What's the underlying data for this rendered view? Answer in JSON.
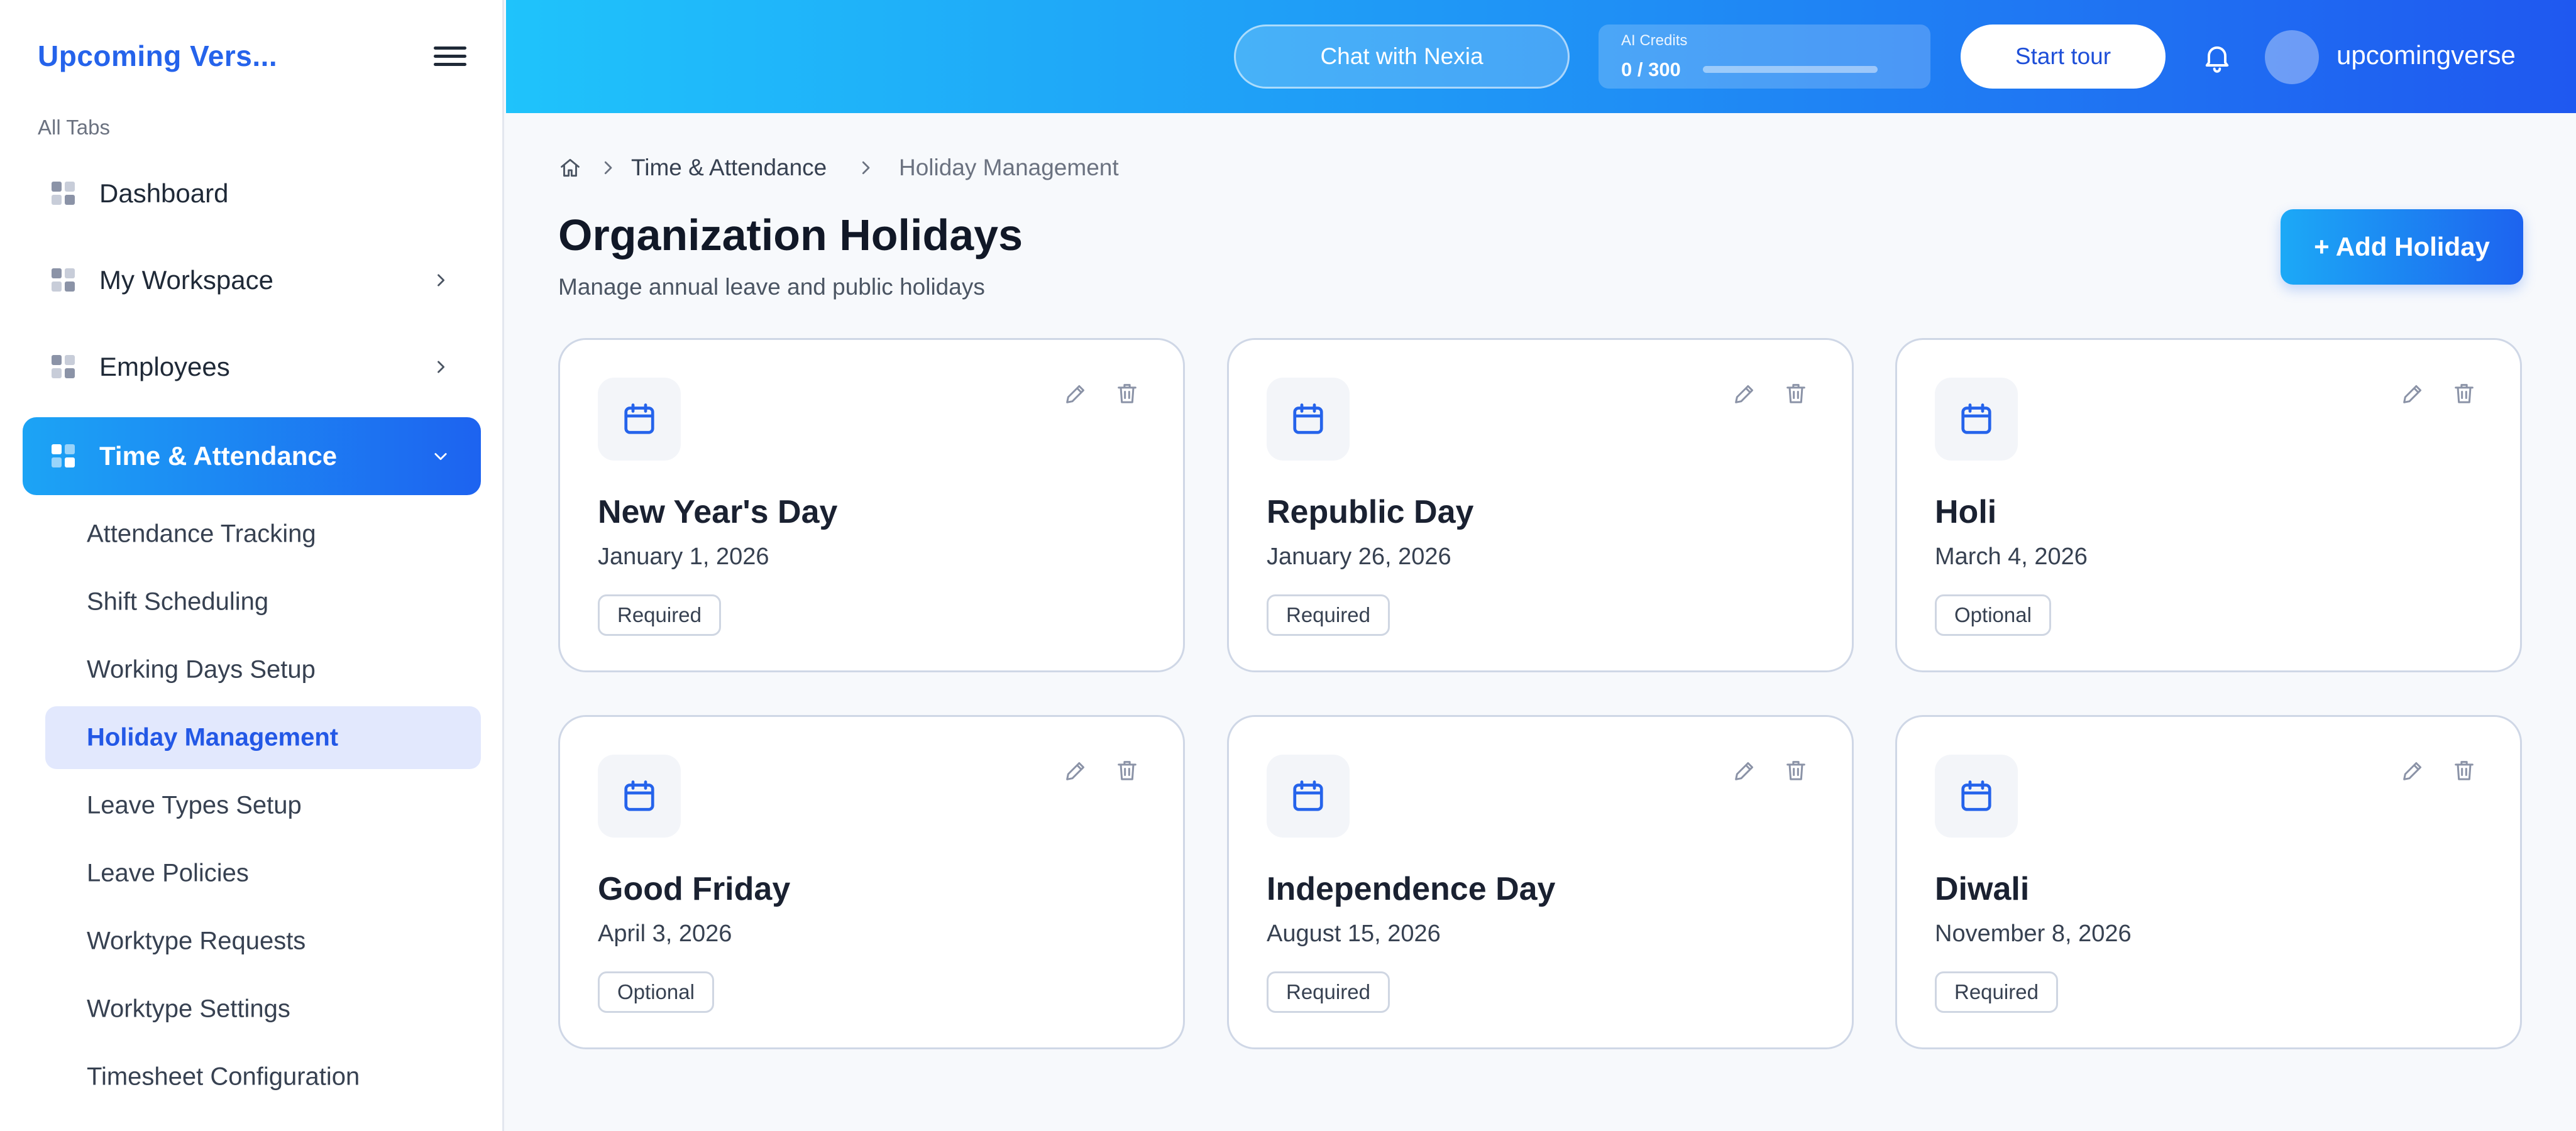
{
  "sidebar": {
    "brand": "Upcoming Vers...",
    "section_label": "All Tabs",
    "items": [
      {
        "label": "Dashboard"
      },
      {
        "label": "My Workspace"
      },
      {
        "label": "Employees"
      },
      {
        "label": "Time & Attendance"
      }
    ],
    "subitems": [
      {
        "label": "Attendance Tracking"
      },
      {
        "label": "Shift Scheduling"
      },
      {
        "label": "Working Days Setup"
      },
      {
        "label": "Holiday Management"
      },
      {
        "label": "Leave Types Setup"
      },
      {
        "label": "Leave Policies"
      },
      {
        "label": "Worktype Requests"
      },
      {
        "label": "Worktype Settings"
      },
      {
        "label": "Timesheet Configuration"
      }
    ]
  },
  "topbar": {
    "chat_label": "Chat with Nexia",
    "credits_label": "AI Credits",
    "credits_value": "0 / 300",
    "credits_fraction": 0,
    "tour_label": "Start tour",
    "username": "upcomingverse"
  },
  "breadcrumb": {
    "parent": "Time & Attendance",
    "current": "Holiday Management"
  },
  "page": {
    "title": "Organization Holidays",
    "subtitle": "Manage annual leave and public holidays",
    "add_label": "+ Add Holiday"
  },
  "holidays": [
    {
      "name": "New Year's Day",
      "date": "January 1, 2026",
      "type": "Required"
    },
    {
      "name": "Republic Day",
      "date": "January 26, 2026",
      "type": "Required"
    },
    {
      "name": "Holi",
      "date": "March 4, 2026",
      "type": "Optional"
    },
    {
      "name": "Good Friday",
      "date": "April 3, 2026",
      "type": "Optional"
    },
    {
      "name": "Independence Day",
      "date": "August 15, 2026",
      "type": "Required"
    },
    {
      "name": "Diwali",
      "date": "November 8, 2026",
      "type": "Required"
    }
  ],
  "colors": {
    "accent": "#2563eb",
    "gradient_start": "#1fc3fb",
    "gradient_end": "#1f58f0",
    "active_subitem_bg": "#e2e8fd"
  },
  "icons": {
    "menu": "hamburger-icon",
    "nav": "grid-icon",
    "home": "home-icon",
    "holiday": "calendar-icon",
    "edit": "pencil-icon",
    "delete": "trash-icon",
    "notifications": "bell-icon"
  }
}
